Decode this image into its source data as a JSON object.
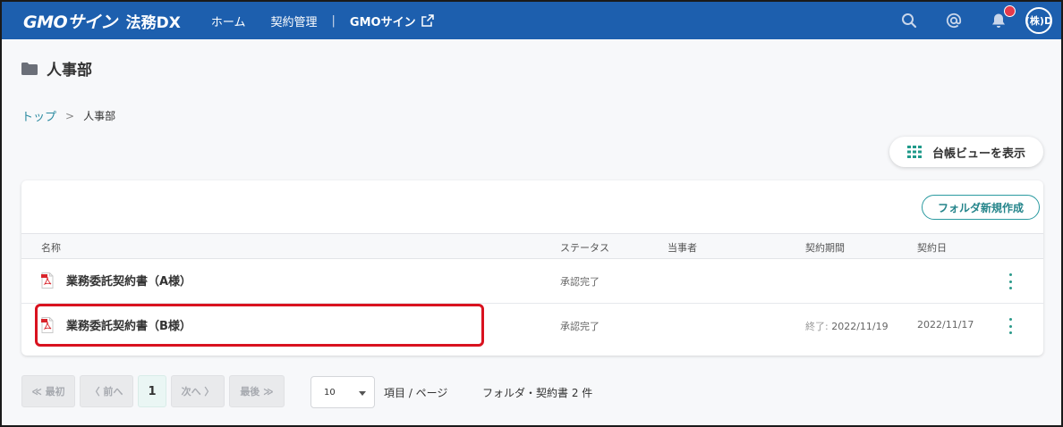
{
  "header": {
    "logo": "GMOサイン",
    "product": "法務DX",
    "nav": [
      "ホーム",
      "契約管理"
    ],
    "separator": "|",
    "external_link": "GMOサイン",
    "avatar_text": "(株)D"
  },
  "page": {
    "title": "人事部"
  },
  "breadcrumb": {
    "root": "トップ",
    "separator": ">",
    "current": "人事部"
  },
  "actions": {
    "ledger_view": "台帳ビューを表示",
    "new_folder": "フォルダ新規作成"
  },
  "table": {
    "columns": [
      "名称",
      "ステータス",
      "当事者",
      "契約期間",
      "契約日"
    ],
    "rows": [
      {
        "name": "業務委託契約書（A様）",
        "status": "承認完了",
        "party": "",
        "period_label": "",
        "period": "",
        "date": ""
      },
      {
        "name": "業務委託契約書（B様）",
        "status": "承認完了",
        "party": "",
        "period_label": "終了: ",
        "period": "2022/11/19",
        "date": "2022/11/17"
      }
    ]
  },
  "pagination": {
    "first": "≪ 最初",
    "prev": "〈 前へ",
    "current_page": "1",
    "next": "次へ 〉",
    "last": "最後 ≫",
    "per_page": "10",
    "per_page_label": "項目 / ページ",
    "count_text": "フォルダ・契約書 2 件"
  },
  "colors": {
    "header_bg": "#1d5fae",
    "accent_teal": "#2a9aa0",
    "highlight_red": "#d9121f",
    "notification_red": "#e53a4b"
  },
  "icons": [
    "search-icon",
    "mention-icon",
    "bell-icon",
    "folder-icon",
    "grid-icon",
    "pdf-file-icon",
    "kebab-menu-icon",
    "external-link-icon",
    "caret-down-icon"
  ]
}
